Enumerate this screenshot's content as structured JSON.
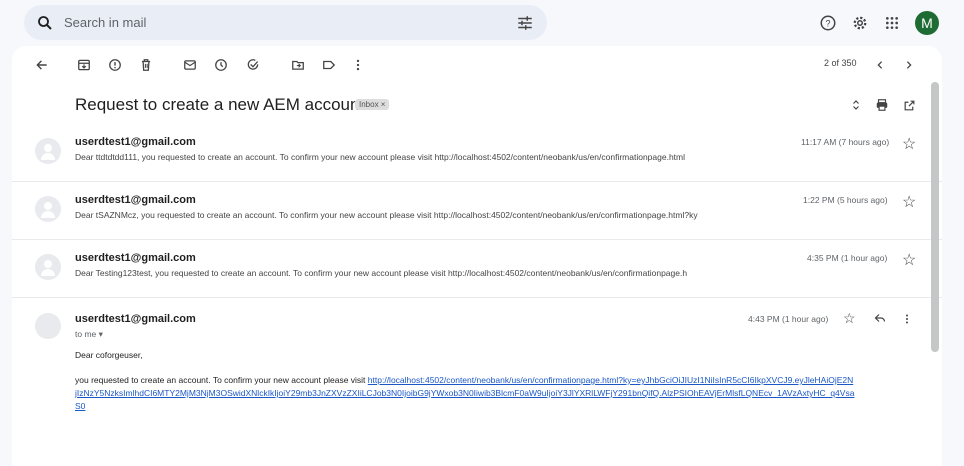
{
  "search": {
    "placeholder": "Search in mail"
  },
  "header": {
    "avatar_letter": "M"
  },
  "toolbar": {
    "pager": "2 of 350"
  },
  "thread": {
    "subject": "Request to create a new AEM account",
    "label": "Inbox ×"
  },
  "messages": [
    {
      "from": "userdtest1@gmail.com",
      "snippet": "Dear ttdtdtdd111, you requested to create an account. To confirm your new account please visit http://localhost:4502/content/neobank/us/en/confirmationpage.html",
      "time": "11:17 AM (7 hours ago)"
    },
    {
      "from": "userdtest1@gmail.com",
      "snippet": "Dear tSAZNMcz, you requested to create an account. To confirm your new account please visit http://localhost:4502/content/neobank/us/en/confirmationpage.html?ky",
      "time": "1:22 PM (5 hours ago)"
    },
    {
      "from": "userdtest1@gmail.com",
      "snippet": "Dear Testing123test, you requested to create an account. To confirm your new account please visit http://localhost:4502/content/neobank/us/en/confirmationpage.h",
      "time": "4:35 PM (1 hour ago)"
    }
  ],
  "open_message": {
    "from": "userdtest1@gmail.com",
    "to": "to me ▾",
    "time": "4:43 PM (1 hour ago)",
    "greeting": "Dear coforgeuser,",
    "body_text": "you requested to create an account. To confirm your new account please visit ",
    "link": "http://localhost:4502/content/neobank/us/en/confirmationpage.html?ky=eyJhbGciOiJIUzI1NiIsInR5cCI6IkpXVCJ9.eyJleHAiOjE2NjIzNzY5NzksImlhdCI6MTY2MjM3NjM3OSwidXNlckIkIjoiY29mb3JnZXVzZXIiLCJob3N0IjoibG9jYWxob3N0Iiwib3BlcmF0aW9uIjoiY3JlYXRlLWFjY291bnQifQ.AlzPSIOhEAVjErMlsfLQNEcv_1AVzAxtyHC_q4VsaS0"
  },
  "colors": {
    "avatar_bg": "#1e6b34",
    "link": "#1a57c7",
    "search_bg": "#e9eef6"
  }
}
